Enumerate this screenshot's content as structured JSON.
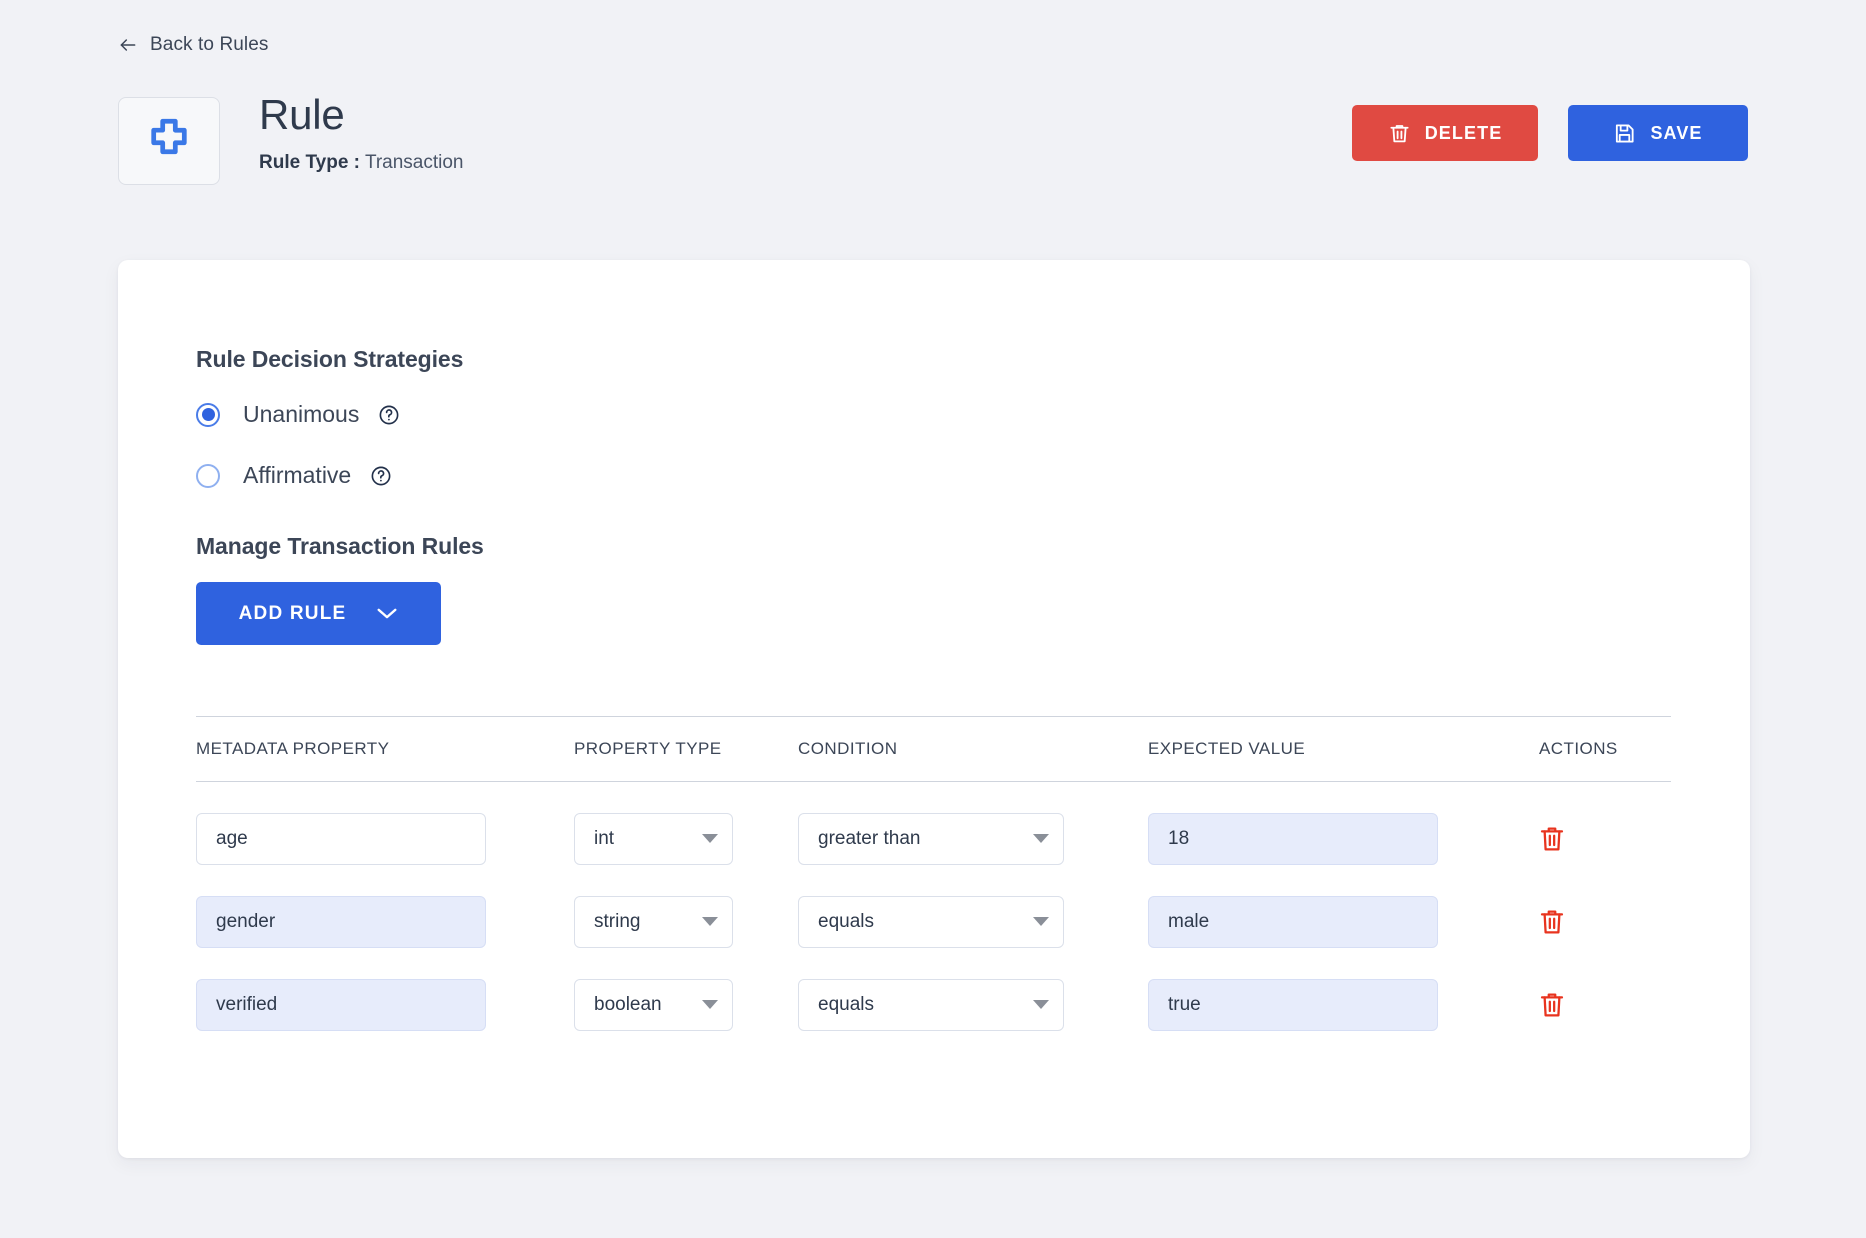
{
  "nav": {
    "back_label": "Back to Rules",
    "back_icon": "arrow-left-icon"
  },
  "header": {
    "badge_icon": "plus-icon",
    "title": "Rule",
    "rule_type_label": "Rule Type :",
    "rule_type_value": "Transaction",
    "delete_label": "DELETE",
    "delete_icon": "trash-icon",
    "save_label": "SAVE",
    "save_icon": "save-floppy-icon"
  },
  "strategies": {
    "title": "Rule Decision Strategies",
    "options": [
      {
        "label": "Unanimous",
        "selected": true,
        "help_icon": "help-circle-icon"
      },
      {
        "label": "Affirmative",
        "selected": false,
        "help_icon": "help-circle-icon"
      }
    ]
  },
  "manage": {
    "title": "Manage Transaction Rules",
    "add_rule_label": "ADD RULE",
    "add_rule_icon": "chevron-down-icon"
  },
  "table": {
    "headers": {
      "metadata": "METADATA PROPERTY",
      "type": "PROPERTY TYPE",
      "condition": "CONDITION",
      "expected": "EXPECTED VALUE",
      "actions": "ACTIONS"
    },
    "rows": [
      {
        "metadata": "age",
        "type": "int",
        "condition": "greater than",
        "expected": "18",
        "delete_icon": "trash-icon"
      },
      {
        "metadata": "gender",
        "type": "string",
        "condition": "equals",
        "expected": "male",
        "delete_icon": "trash-icon"
      },
      {
        "metadata": "verified",
        "type": "boolean",
        "condition": "equals",
        "expected": "true",
        "delete_icon": "trash-icon"
      }
    ]
  },
  "colors": {
    "page_background": "#f1f2f6",
    "card_background": "#ffffff",
    "primary_blue": "#2f62df",
    "danger_red": "#e04a42",
    "trash_red": "#e8341f",
    "filled_input": "#e7ecfb",
    "text_dark": "#3c4657"
  }
}
